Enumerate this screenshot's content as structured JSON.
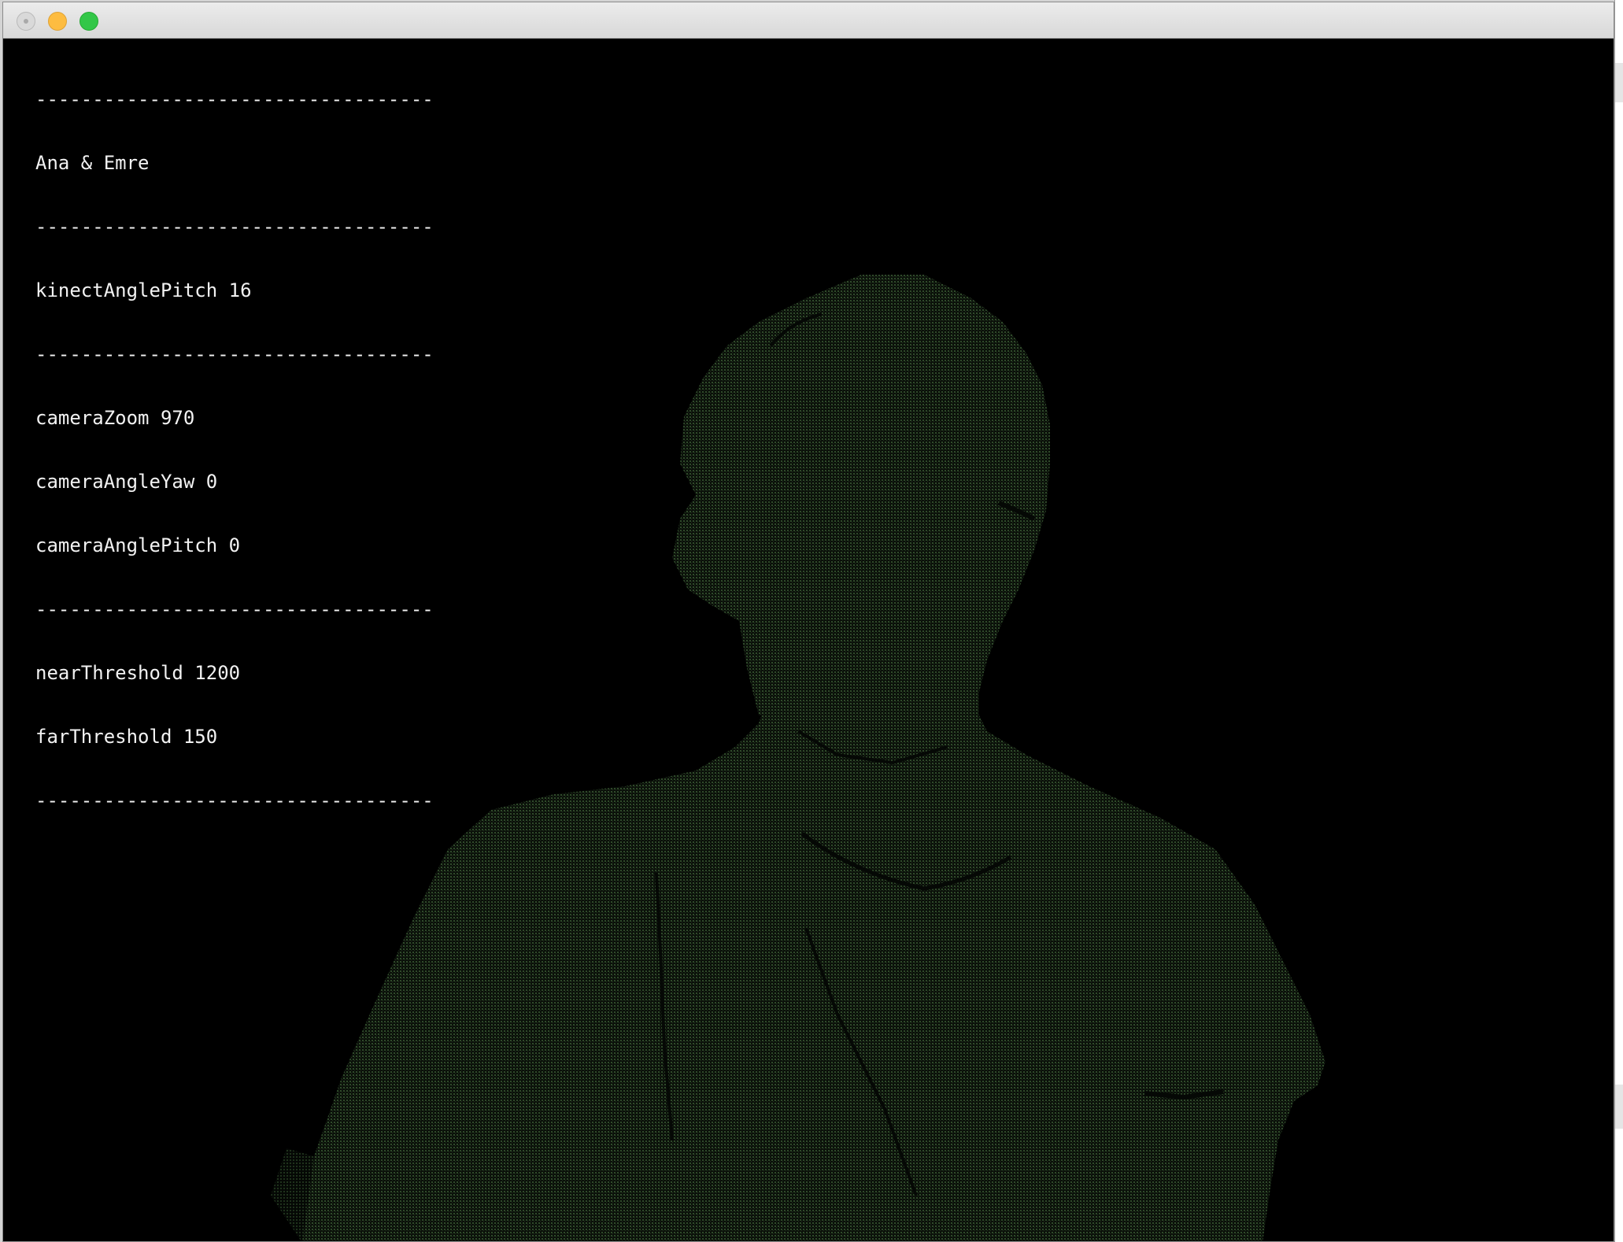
{
  "window": {
    "controls": [
      "close",
      "minimize",
      "maximize"
    ]
  },
  "hud": {
    "separator": "-----------------------------------",
    "title": "Ana & Emre",
    "kinect_angle_pitch": "kinectAnglePitch 16",
    "camera_zoom": "cameraZoom 970",
    "camera_angle_yaw": "cameraAngleYaw 0",
    "camera_angle_pitch": "cameraAnglePitch 0",
    "near_threshold": "nearThreshold 1200",
    "far_threshold": "farThreshold 150"
  },
  "pointcloud": {
    "color": "#2f4a2a"
  },
  "colors": {
    "background": "#000000",
    "hud_text": "#f2f2f2",
    "traffic_close": "#d9d9d9",
    "traffic_minimize": "#fdbc40",
    "traffic_maximize": "#33c748"
  }
}
